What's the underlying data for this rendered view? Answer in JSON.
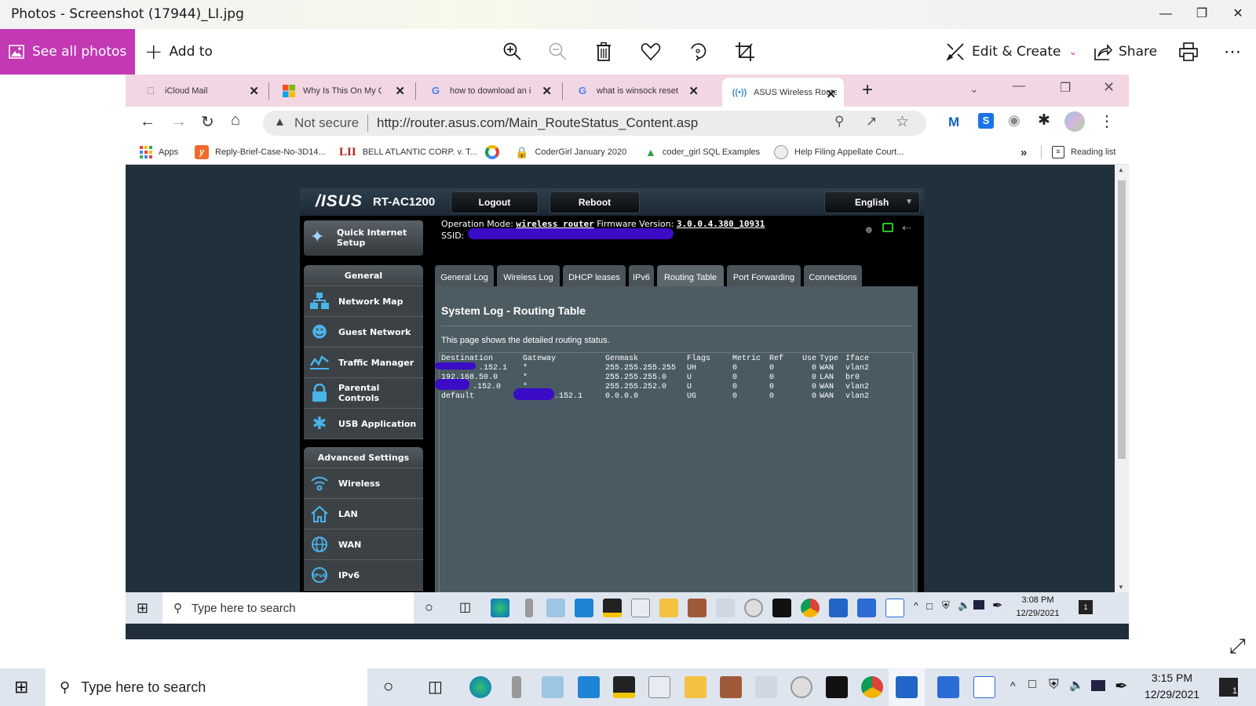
{
  "photos_app": {
    "title": "Photos - Screenshot (17944)_LI.jpg",
    "see_all_photos": "See all photos",
    "add_to": "Add to",
    "edit_create": "Edit & Create",
    "share": "Share",
    "toolbar_icons": [
      "zoom-in-icon",
      "zoom-out-icon",
      "delete-icon",
      "favorite-icon",
      "rotate-icon",
      "crop-icon"
    ],
    "accent_color": "#c239b3"
  },
  "browser": {
    "tabs": [
      {
        "label": "iCloud Mail",
        "icon": "apple-icon",
        "active": false
      },
      {
        "label": "Why Is This On My Cc",
        "icon": "microsoft-icon",
        "active": false
      },
      {
        "label": "how to download an i",
        "icon": "google-icon",
        "active": false
      },
      {
        "label": "what is winsock reset",
        "icon": "google-icon",
        "active": false
      },
      {
        "label": "ASUS Wireless Router",
        "icon": "wireless-icon",
        "active": true
      }
    ],
    "security_label": "Not secure",
    "url": "http://router.asus.com/Main_RouteStatus_Content.asp",
    "bookmarks": [
      {
        "label": "Apps",
        "icon": "apps-grid-icon"
      },
      {
        "label": "Reply-Brief-Case-No-3D14...",
        "icon": "y-icon"
      },
      {
        "label": "BELL ATLANTIC CORP. v. T...",
        "icon": "lii-icon"
      },
      {
        "label": "",
        "icon": "google-drive-circle-icon"
      },
      {
        "label": "CoderGirl January 2020",
        "icon": "lock-icon"
      },
      {
        "label": "coder_girl SQL Examples",
        "icon": "tree-icon"
      },
      {
        "label": "Help Filing Appellate Court...",
        "icon": "seal-icon"
      }
    ],
    "bookmarks_overflow": "»",
    "reading_list": "Reading list",
    "lii_text": "LII"
  },
  "router": {
    "brand": "/ISUS",
    "model": "RT-AC1200",
    "logout": "Logout",
    "reboot": "Reboot",
    "language": "English",
    "operation_mode_label": "Operation Mode:",
    "operation_mode": "wireless router",
    "firmware_label": "Firmware Version:",
    "firmware": "3.0.0.4.380_10931",
    "ssid_label": "SSID:",
    "quick_setup": "Quick Internet Setup",
    "general_header": "General",
    "general_items": [
      {
        "label": "Network Map",
        "icon": "network-map-icon"
      },
      {
        "label": "Guest Network",
        "icon": "guest-network-icon"
      },
      {
        "label": "Traffic Manager",
        "icon": "traffic-manager-icon"
      },
      {
        "label": "Parental Controls",
        "icon": "parental-lock-icon"
      },
      {
        "label": "USB Application",
        "icon": "puzzle-icon"
      }
    ],
    "advanced_header": "Advanced Settings",
    "advanced_items": [
      {
        "label": "Wireless",
        "icon": "wifi-icon"
      },
      {
        "label": "LAN",
        "icon": "home-icon"
      },
      {
        "label": "WAN",
        "icon": "globe-icon"
      },
      {
        "label": "IPv6",
        "icon": "ipv6-globe-icon"
      }
    ],
    "log_tabs": [
      "General Log",
      "Wireless Log",
      "DHCP leases",
      "IPv6",
      "Routing Table",
      "Port Forwarding",
      "Connections"
    ],
    "active_tab": "Routing Table",
    "page_title": "System Log - Routing Table",
    "description": "This page shows the detailed routing status.",
    "table_headers": [
      "Destination",
      "Gateway",
      "Genmask",
      "Flags",
      "Metric",
      "Ref",
      "Use",
      "Type",
      "Iface"
    ],
    "table_rows": [
      [
        "[redacted].152.1",
        "*",
        "255.255.255.255",
        "UH",
        "0",
        "0",
        "0",
        "WAN",
        "vlan2"
      ],
      [
        "192.168.50.0",
        "*",
        "255.255.255.0",
        "U",
        "0",
        "0",
        "0",
        "LAN",
        "br0"
      ],
      [
        "[redacted].152.0",
        "*",
        "255.255.252.0",
        "U",
        "0",
        "0",
        "0",
        "WAN",
        "vlan2"
      ],
      [
        "default",
        "[redacted].152.1",
        "0.0.0.0",
        "UG",
        "0",
        "0",
        "0",
        "WAN",
        "vlan2"
      ]
    ]
  },
  "inner_taskbar": {
    "search_placeholder": "Type here to search",
    "time": "3:08 PM",
    "date": "12/29/2021",
    "notification_count": "1"
  },
  "outer_taskbar": {
    "search_placeholder": "Type here to search",
    "time": "3:15 PM",
    "date": "12/29/2021",
    "notification_count": "1"
  }
}
